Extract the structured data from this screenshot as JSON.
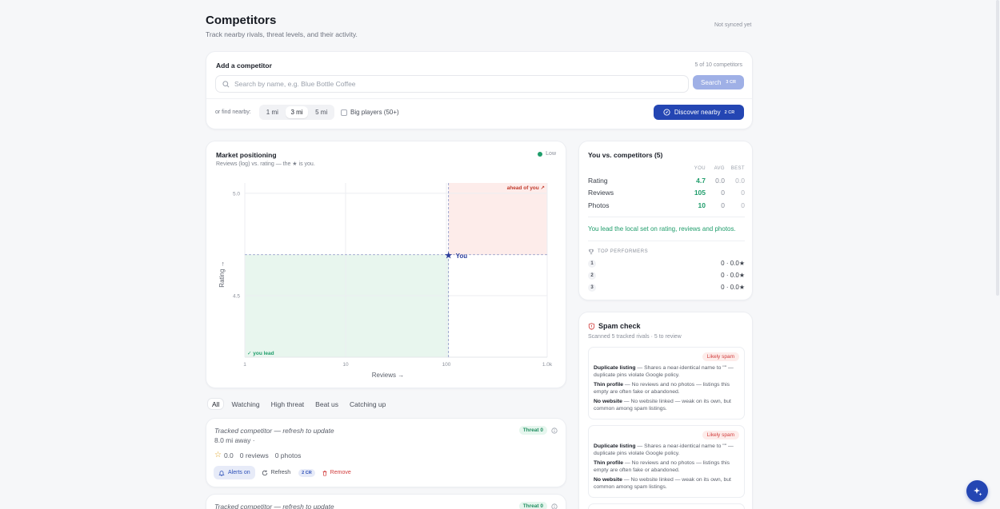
{
  "header": {
    "title": "Competitors",
    "subtitle": "Track nearby rivals, threat levels, and their activity.",
    "sync_status": "Not synced yet"
  },
  "add_competitor": {
    "title": "Add a competitor",
    "count": "5 of 10 competitors",
    "search_placeholder": "Search by name, e.g. Blue Bottle Coffee",
    "search_button": "Search",
    "search_cost": "3 CR",
    "nearby_label": "or find nearby:",
    "radius_options": [
      "1 mi",
      "3 mi",
      "5 mi"
    ],
    "radius_selected": "3 mi",
    "big_players_label": "Big players (50+)",
    "discover_button": "Discover nearby",
    "discover_cost": "2 CR"
  },
  "market": {
    "title": "Market positioning",
    "subtitle": "Reviews (log) vs. rating — the ★ is you.",
    "status": "Low",
    "ahead_label": "ahead of you ↗",
    "lead_label": "✓ you lead",
    "you_label": "You",
    "colors": {
      "ahead": "#fdecea",
      "lead": "#e8f6ee",
      "you": "#2c3e9c"
    },
    "chart_data": {
      "type": "scatter",
      "xlabel": "Reviews →",
      "ylabel": "Rating →",
      "x_scale": "log",
      "x_ticks": [
        "1",
        "10",
        "100",
        "1.0k"
      ],
      "y_ticks": [
        "5.0",
        "4.5"
      ],
      "xlim": [
        1,
        1000
      ],
      "ylim": [
        4.2,
        5.05
      ],
      "you": {
        "reviews": 105,
        "rating": 4.7
      },
      "grid": true
    }
  },
  "filters": {
    "tabs": [
      "All",
      "Watching",
      "High threat",
      "Beat us",
      "Catching up"
    ],
    "active": "All"
  },
  "competitors": [
    {
      "name": "Tracked competitor — refresh to update",
      "threat": "Threat 0",
      "distance": "8.0 mi away ·",
      "rating": "0.0",
      "reviews": "0 reviews",
      "photos": "0 photos",
      "alerts": "Alerts on",
      "refresh": "Refresh",
      "refresh_cost": "2 CR",
      "remove": "Remove"
    },
    {
      "name": "Tracked competitor — refresh to update",
      "threat": "Threat 0"
    }
  ],
  "comparison": {
    "title": "You vs. competitors (5)",
    "col_you": "YOU",
    "col_avg": "AVG",
    "col_best": "BEST",
    "rows": [
      {
        "label": "Rating",
        "you": "4.7",
        "avg": "0.0",
        "best": "0.0"
      },
      {
        "label": "Reviews",
        "you": "105",
        "avg": "0",
        "best": "0"
      },
      {
        "label": "Photos",
        "you": "10",
        "avg": "0",
        "best": "0"
      }
    ],
    "summary": "You lead the local set on rating, reviews and photos.",
    "top_title": "TOP PERFORMERS",
    "top": [
      {
        "rank": "1",
        "value": "0 · 0.0★"
      },
      {
        "rank": "2",
        "value": "0 · 0.0★"
      },
      {
        "rank": "3",
        "value": "0 · 0.0★"
      }
    ]
  },
  "spam": {
    "title": "Spam check",
    "subtitle": "Scanned 5 tracked rivals · 5 to review",
    "cards": [
      {
        "badge": "Likely spam",
        "items": [
          {
            "label": "Duplicate listing",
            "text": " — Shares a near-identical name to \"\" — duplicate pins violate Google policy."
          },
          {
            "label": "Thin profile",
            "text": " — No reviews and no photos — listings this empty are often fake or abandoned."
          },
          {
            "label": "No website",
            "text": " — No website linked — weak on its own, but common among spam listings."
          }
        ]
      },
      {
        "badge": "Likely spam",
        "items": [
          {
            "label": "Duplicate listing",
            "text": " — Shares a near-identical name to \"\" — duplicate pins violate Google policy."
          },
          {
            "label": "Thin profile",
            "text": " — No reviews and no photos — listings this empty are often fake or abandoned."
          },
          {
            "label": "No website",
            "text": " — No website linked — weak on its own, but common among spam listings."
          }
        ]
      }
    ]
  },
  "fab_icon": "sparkle-icon"
}
